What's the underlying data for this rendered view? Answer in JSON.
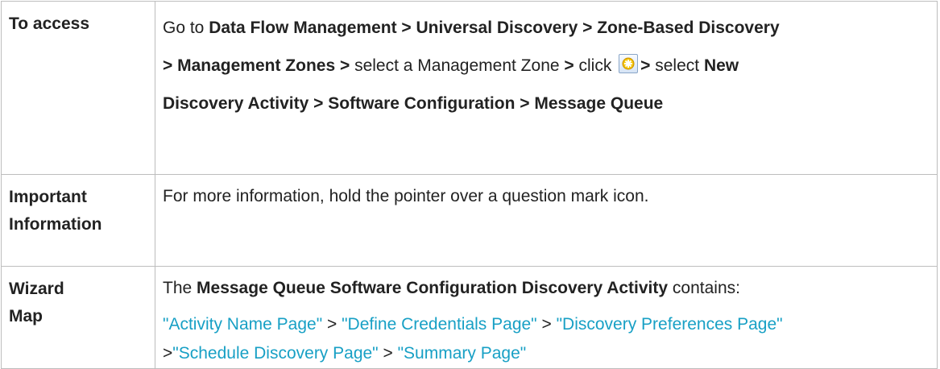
{
  "access": {
    "header": "To access",
    "t1": "Go to ",
    "b1": "Data Flow Management > Universal Discovery > Zone-Based Discovery",
    "b2": "> Management Zones >",
    "t2": " select a Management Zone ",
    "b3": ">",
    "t3": " click ",
    "b4": ">",
    "t4": " select ",
    "b5": "New",
    "b6": "Discovery Activity > Software Configuration > Message Queue",
    "icon": "new-activity-icon"
  },
  "important": {
    "header1": "Important",
    "header2": "Information",
    "text": "For more information, hold the pointer over a question mark icon."
  },
  "wizard": {
    "header1": "Wizard",
    "header2": "Map",
    "t1": "The ",
    "b1": "Message Queue Software Configuration Discovery Activity",
    "t2": " contains:",
    "links": [
      "\"Activity Name Page\"",
      "\"Define Credentials Page\"",
      "\"Discovery Preferences Page\"",
      "\"Schedule Discovery Page\"",
      "\"Summary Page\""
    ],
    "sep": " > ",
    "sep_wrap": ">"
  },
  "colors": {
    "link": "#18a0c5",
    "border": "#bdbdbd"
  }
}
